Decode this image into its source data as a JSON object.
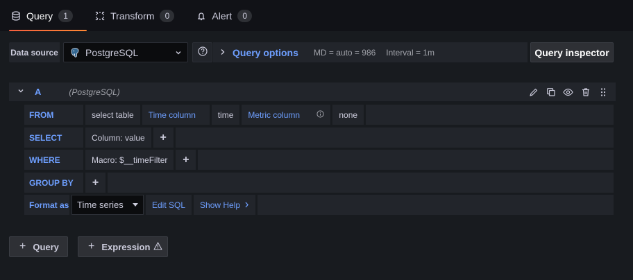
{
  "tabs": [
    {
      "label": "Query",
      "count": "1",
      "icon": "database-icon",
      "active": true
    },
    {
      "label": "Transform",
      "count": "0",
      "icon": "transform-icon",
      "active": false
    },
    {
      "label": "Alert",
      "count": "0",
      "icon": "bell-icon",
      "active": false
    }
  ],
  "datasource": {
    "label": "Data source",
    "selected": "PostgreSQL",
    "icon": "postgresql-icon"
  },
  "query_options": {
    "title": "Query options",
    "md": "MD = auto = 986",
    "interval": "Interval = 1m"
  },
  "query_inspector": {
    "label": "Query inspector"
  },
  "query": {
    "ref_id": "A",
    "datasource_name": "(PostgreSQL)",
    "from": {
      "keyword": "FROM",
      "table": "select table",
      "time_column_label": "Time column",
      "time_column_value": "time",
      "metric_column_label": "Metric column",
      "metric_column_value": "none"
    },
    "select": {
      "keyword": "SELECT",
      "column": "Column: value",
      "plus": "+"
    },
    "where": {
      "keyword": "WHERE",
      "macro": "Macro: $__timeFilter",
      "plus": "+"
    },
    "group_by": {
      "keyword": "GROUP BY",
      "plus": "+"
    },
    "format": {
      "keyword": "Format as",
      "selected": "Time series",
      "edit_sql": "Edit SQL",
      "show_help": "Show Help"
    }
  },
  "bottom": {
    "add_query": "Query",
    "add_expression": "Expression"
  },
  "colors": {
    "accent_blue": "#6e9fff",
    "active_tab": "#f55f3e",
    "background": "#181b1f"
  }
}
